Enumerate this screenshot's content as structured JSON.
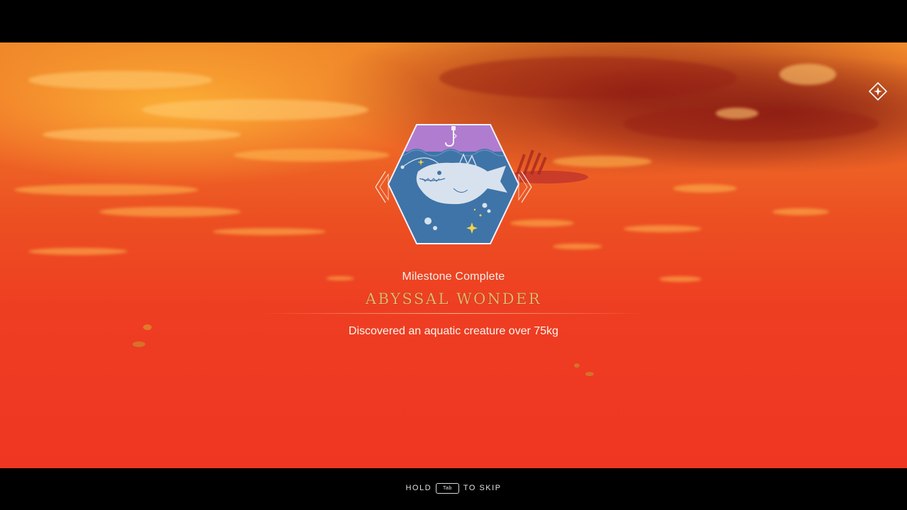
{
  "milestone": {
    "label": "Milestone Complete",
    "title": "ABYSSAL WONDER",
    "description": "Discovered an aquatic creature over 75kg"
  },
  "skip_hint": {
    "hold": "HOLD",
    "key": "Tab",
    "action": "TO SKIP"
  },
  "icons": {
    "badge": "anglerfish-hexagon-badge",
    "compass": "compass-diamond-icon",
    "hook": "fishing-hook-icon"
  },
  "colors": {
    "badge_water": "#3f74a8",
    "badge_top": "#b07cd0",
    "title_gold": "#e7b76a",
    "sky_orange": "#f08a2a",
    "water_red": "#ef3622"
  }
}
